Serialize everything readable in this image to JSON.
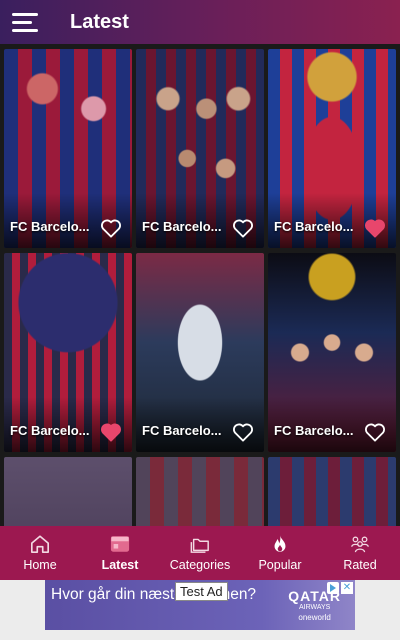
{
  "app_bar": {
    "title": "Latest",
    "menu_icon": "hamburger-menu-icon"
  },
  "colors": {
    "app_bar_start": "#3a1f5e",
    "app_bar_end": "#8a2150",
    "bottom_nav": "#9c1850",
    "heart_favorited": "#e8466c",
    "heart_outline": "#ffffff"
  },
  "wallpapers": [
    {
      "caption": "FC Barcelo...",
      "favorited": false
    },
    {
      "caption": "FC Barcelo...",
      "favorited": false
    },
    {
      "caption": "FC Barcelo...",
      "favorited": true
    },
    {
      "caption": "FC Barcelo...",
      "favorited": true
    },
    {
      "caption": "FC Barcelo...",
      "favorited": false
    },
    {
      "caption": "FC Barcelo...",
      "favorited": false
    },
    {
      "caption": "",
      "favorited": false
    },
    {
      "caption": "",
      "favorited": false
    },
    {
      "caption": "",
      "favorited": false
    }
  ],
  "bottom_nav": {
    "items": [
      {
        "label": "Home",
        "icon": "home-icon",
        "active": false
      },
      {
        "label": "Latest",
        "icon": "latest-icon",
        "active": true
      },
      {
        "label": "Categories",
        "icon": "folders-icon",
        "active": false
      },
      {
        "label": "Popular",
        "icon": "flame-icon",
        "active": false
      },
      {
        "label": "Rated",
        "icon": "group-icon",
        "active": false
      }
    ]
  },
  "ad": {
    "text": "Hvor går din næste ferie hen?",
    "badge": "Test Ad",
    "brand": "QATAR",
    "brand_sub": "AIRWAYS",
    "brand_alliance": "oneworld"
  }
}
